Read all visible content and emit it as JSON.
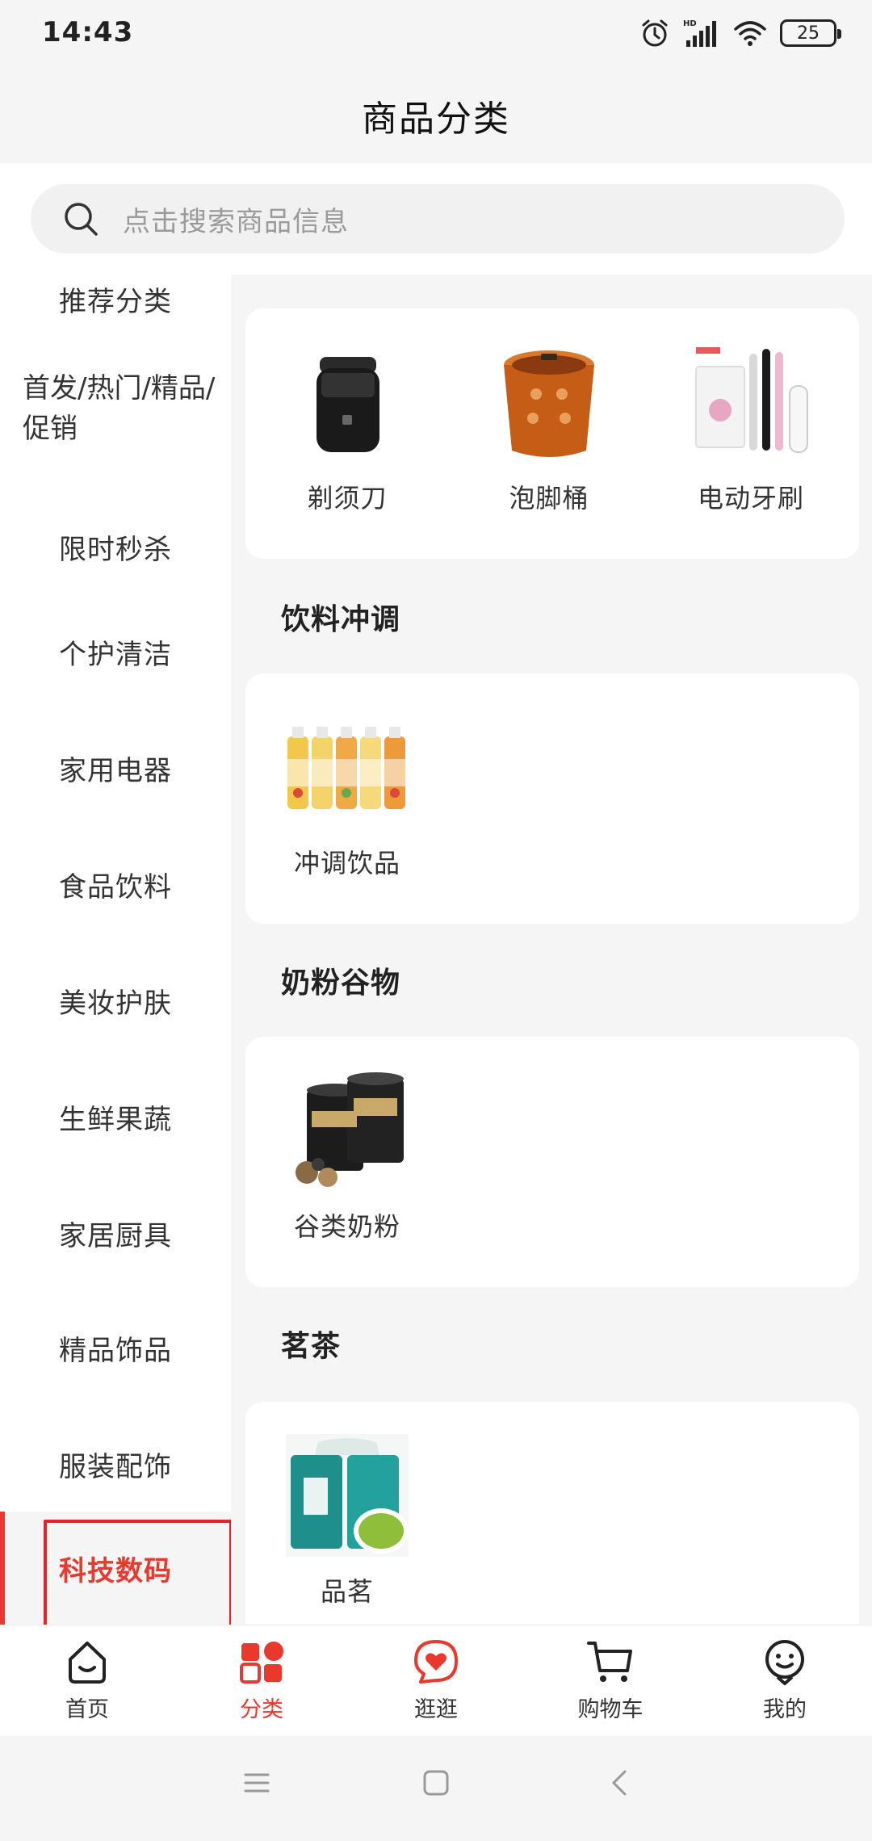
{
  "status_bar": {
    "time": "14:43",
    "battery": "25"
  },
  "header": {
    "title": "商品分类"
  },
  "search": {
    "placeholder": "点击搜索商品信息"
  },
  "sidebar": {
    "items": [
      {
        "label": "推荐分类"
      },
      {
        "label": "首发/热门/精品/促销"
      },
      {
        "label": "限时秒杀"
      },
      {
        "label": "个护清洁"
      },
      {
        "label": "家用电器"
      },
      {
        "label": "食品饮料"
      },
      {
        "label": "美妆护肤"
      },
      {
        "label": "生鲜果蔬"
      },
      {
        "label": "家居厨具"
      },
      {
        "label": "精品饰品"
      },
      {
        "label": "服装配饰"
      },
      {
        "label": "科技数码"
      }
    ],
    "active_label": "科技数码"
  },
  "content": {
    "top_products": [
      {
        "name": "剃须刀",
        "icon": "shaver-image"
      },
      {
        "name": "泡脚桶",
        "icon": "foot-bath-image"
      },
      {
        "name": "电动牙刷",
        "icon": "electric-toothbrush-image"
      }
    ],
    "sections": [
      {
        "title": "饮料冲调",
        "products": [
          {
            "name": "冲调饮品",
            "icon": "tea-drink-bottles-image"
          }
        ]
      },
      {
        "title": "奶粉谷物",
        "products": [
          {
            "name": "谷类奶粉",
            "icon": "grain-powder-cans-image"
          }
        ]
      },
      {
        "title": "茗茶",
        "products": [
          {
            "name": "品茗",
            "icon": "green-tea-gift-box-image"
          }
        ]
      }
    ]
  },
  "bottom_nav": {
    "items": [
      {
        "label": "首页",
        "icon": "home-icon"
      },
      {
        "label": "分类",
        "icon": "category-icon"
      },
      {
        "label": "逛逛",
        "icon": "browse-heart-icon"
      },
      {
        "label": "购物车",
        "icon": "cart-icon"
      },
      {
        "label": "我的",
        "icon": "profile-icon"
      }
    ],
    "active_index": 1
  },
  "colors": {
    "accent": "#e8392c",
    "background": "#f5f5f5",
    "card": "#ffffff",
    "search_bg": "#f1f1f1"
  }
}
